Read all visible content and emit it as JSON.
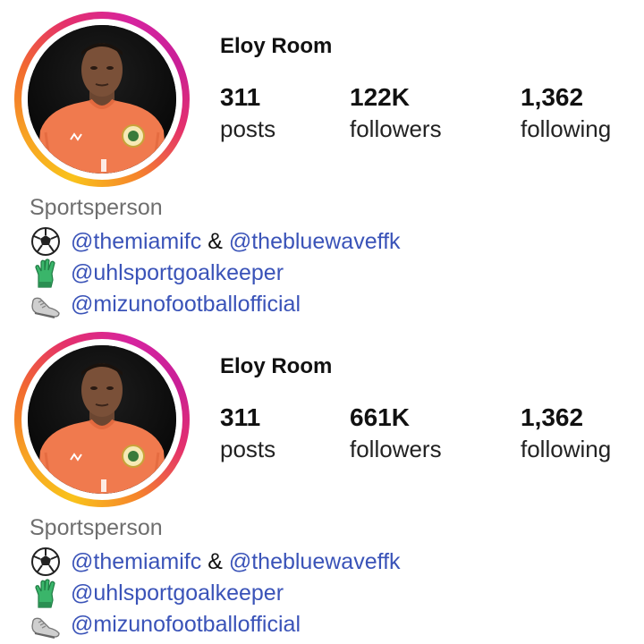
{
  "profiles": [
    {
      "username": "Eloy Room",
      "stats": {
        "posts": {
          "value": "311",
          "label": "posts"
        },
        "followers": {
          "value": "122K",
          "label": "followers"
        },
        "following": {
          "value": "1,362",
          "label": "following"
        }
      },
      "category": "Sportsperson",
      "bio": {
        "line1": {
          "emoji": "soccer-ball-icon",
          "mention1": "@themiamifc",
          "sep": "&",
          "mention2": "@thebluewaveffk"
        },
        "line2": {
          "emoji": "gloves-icon",
          "mention": "@uhlsportgoalkeeper"
        },
        "line3": {
          "emoji": "football-boot-icon",
          "mention": "@mizunofootballofficial"
        }
      }
    },
    {
      "username": "Eloy Room",
      "stats": {
        "posts": {
          "value": "311",
          "label": "posts"
        },
        "followers": {
          "value": "661K",
          "label": "followers"
        },
        "following": {
          "value": "1,362",
          "label": "following"
        }
      },
      "category": "Sportsperson",
      "bio": {
        "line1": {
          "emoji": "soccer-ball-icon",
          "mention1": "@themiamifc",
          "sep": "&",
          "mention2": "@thebluewaveffk"
        },
        "line2": {
          "emoji": "gloves-icon",
          "mention": "@uhlsportgoalkeeper"
        },
        "line3": {
          "emoji": "football-boot-icon",
          "mention": "@mizunofootballofficial"
        }
      }
    }
  ],
  "colors": {
    "link": "#3a53b8",
    "category": "#6e6e6e",
    "jersey": "#f07a4e",
    "glove": "#3ab56a"
  }
}
